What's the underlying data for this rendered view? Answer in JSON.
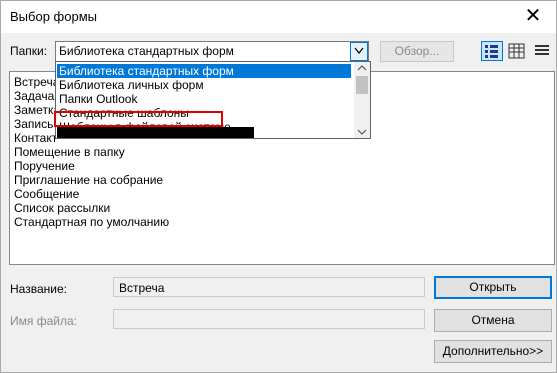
{
  "window": {
    "title": "Выбор формы",
    "close_glyph": "✕"
  },
  "folder": {
    "label": "Папки:",
    "selected": "Библиотека стандартных форм",
    "browse_label": "Обзор...",
    "options": [
      "Библиотека стандартных форм",
      "Библиотека личных форм",
      "Папки Outlook",
      "Стандартные шаблоны",
      "Шаблоны в файловой системе"
    ]
  },
  "view_icons": [
    "large-icons-icon",
    "small-icons-icon",
    "list-view-icon"
  ],
  "forms_list": [
    "Встреча",
    "Задача",
    "Заметка",
    "Запись в дневнике",
    "Контакт",
    "Помещение в папку",
    "Поручение",
    "Приглашение на собрание",
    "Сообщение",
    "Список рассылки",
    "Стандартная по умолчанию"
  ],
  "name_field": {
    "label": "Название:",
    "value": "Встреча"
  },
  "filename_field": {
    "label": "Имя файла:",
    "value": ""
  },
  "buttons": {
    "open": "Открыть",
    "cancel": "Отмена",
    "advanced": "Дополнительно>>"
  },
  "colors": {
    "accent": "#0078d7",
    "highlight": "#e00000"
  }
}
